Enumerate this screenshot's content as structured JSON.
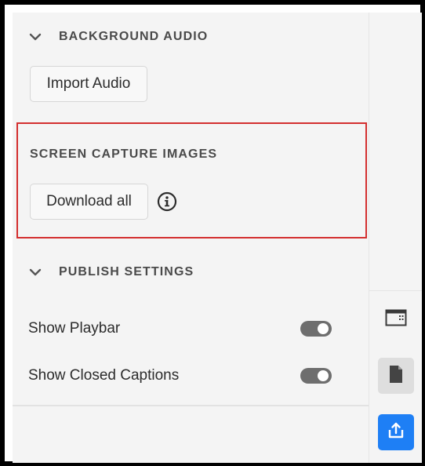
{
  "background_audio": {
    "title": "BACKGROUND AUDIO",
    "import_button": "Import Audio",
    "chevron_icon": "chevron-down-icon"
  },
  "screen_capture": {
    "title": "SCREEN CAPTURE IMAGES",
    "download_button": "Download all",
    "info_icon": "info-icon",
    "highlight_color": "#d32f2f"
  },
  "publish_settings": {
    "title": "PUBLISH SETTINGS",
    "chevron_icon": "chevron-down-icon",
    "options": [
      {
        "label": "Show Playbar",
        "enabled": true
      },
      {
        "label": "Show Closed Captions",
        "enabled": true
      }
    ]
  },
  "right_rail": {
    "items": [
      {
        "icon": "panel-layout-icon",
        "active": false
      },
      {
        "icon": "document-icon",
        "active": true
      },
      {
        "icon": "share-export-icon",
        "primary": true
      }
    ]
  },
  "colors": {
    "accent": "#1e7ff5",
    "toggle_on": "#6e6e6e",
    "panel_bg": "#f4f4f4"
  }
}
